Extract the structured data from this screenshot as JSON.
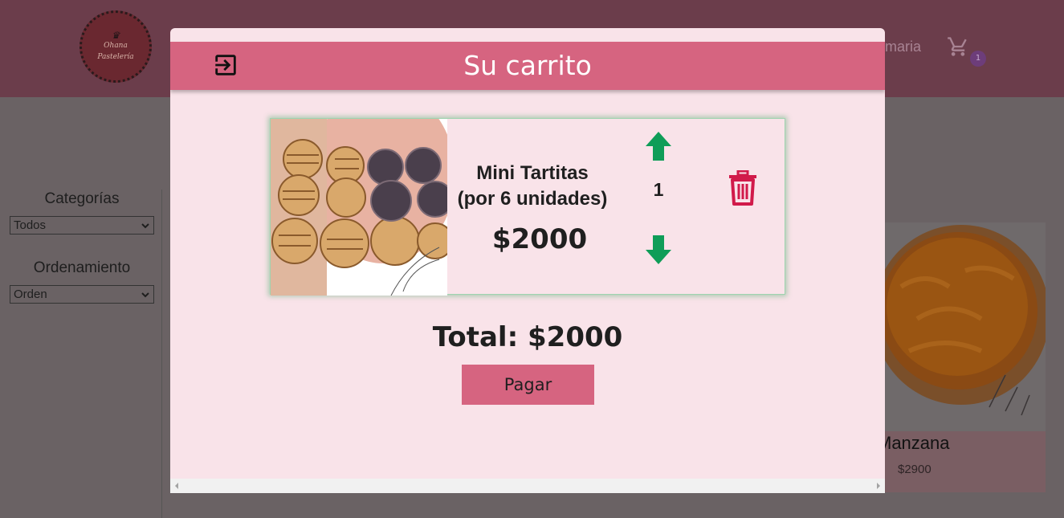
{
  "header": {
    "logo": {
      "line1": "Ohana",
      "line2": "Pastelería"
    },
    "nav_fragment": "maria",
    "cart_icon": "shopping-cart-icon",
    "cart_count": "1"
  },
  "sidebar": {
    "categories_label": "Categorías",
    "categories_selected": "Todos",
    "order_label": "Ordenamiento",
    "order_selected": "Orden"
  },
  "background_product": {
    "title": "Manzana",
    "price": "$2900"
  },
  "modal": {
    "title": "Su carrito",
    "exit_icon": "exit-icon",
    "items": [
      {
        "name": "Mini Tartitas",
        "detail": "(por 6 unidades)",
        "price": "$2000",
        "quantity": "1",
        "icons": {
          "up": "arrow-up-icon",
          "down": "arrow-down-icon",
          "delete": "trash-icon"
        }
      }
    ],
    "total": "Total: $2000",
    "pay_label": "Pagar"
  },
  "colors": {
    "accent": "#d66480",
    "modal_bg": "#f9e3e9",
    "arrow_green": "#0f9d58",
    "trash_red": "#d11a4a"
  }
}
